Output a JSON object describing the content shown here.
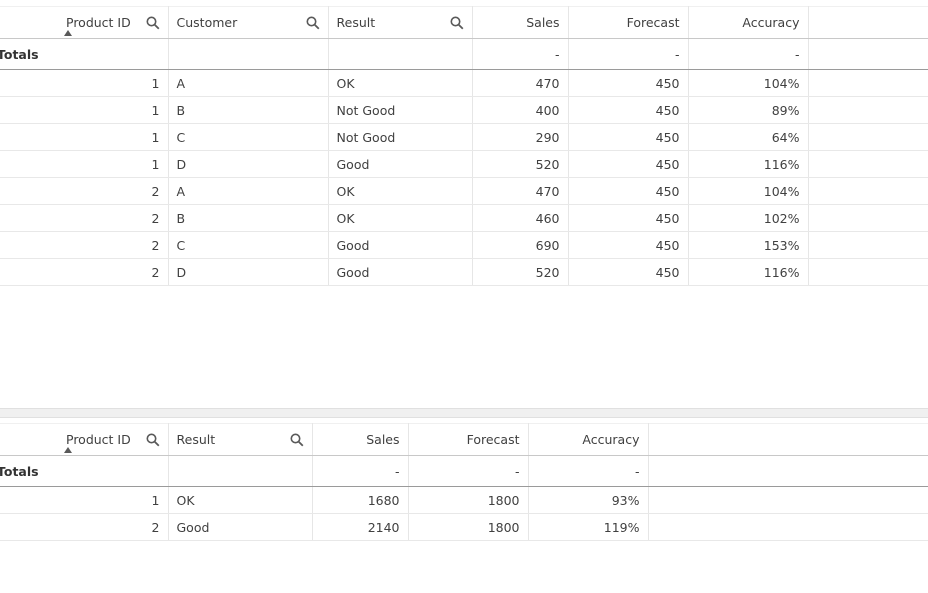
{
  "top_table": {
    "columns": {
      "product_id": "Product ID",
      "customer": "Customer",
      "result": "Result",
      "sales": "Sales",
      "forecast": "Forecast",
      "accuracy": "Accuracy"
    },
    "totals": {
      "label": "Totals",
      "sales": "-",
      "forecast": "-",
      "accuracy": "-"
    },
    "rows": [
      {
        "product_id": "1",
        "customer": "A",
        "result": "OK",
        "sales": "470",
        "forecast": "450",
        "accuracy": "104%"
      },
      {
        "product_id": "1",
        "customer": "B",
        "result": "Not Good",
        "sales": "400",
        "forecast": "450",
        "accuracy": "89%"
      },
      {
        "product_id": "1",
        "customer": "C",
        "result": "Not Good",
        "sales": "290",
        "forecast": "450",
        "accuracy": "64%"
      },
      {
        "product_id": "1",
        "customer": "D",
        "result": "Good",
        "sales": "520",
        "forecast": "450",
        "accuracy": "116%"
      },
      {
        "product_id": "2",
        "customer": "A",
        "result": "OK",
        "sales": "470",
        "forecast": "450",
        "accuracy": "104%"
      },
      {
        "product_id": "2",
        "customer": "B",
        "result": "OK",
        "sales": "460",
        "forecast": "450",
        "accuracy": "102%"
      },
      {
        "product_id": "2",
        "customer": "C",
        "result": "Good",
        "sales": "690",
        "forecast": "450",
        "accuracy": "153%"
      },
      {
        "product_id": "2",
        "customer": "D",
        "result": "Good",
        "sales": "520",
        "forecast": "450",
        "accuracy": "116%"
      }
    ]
  },
  "bottom_table": {
    "columns": {
      "product_id": "Product ID",
      "result": "Result",
      "sales": "Sales",
      "forecast": "Forecast",
      "accuracy": "Accuracy"
    },
    "totals": {
      "label": "Totals",
      "sales": "-",
      "forecast": "-",
      "accuracy": "-"
    },
    "rows": [
      {
        "product_id": "1",
        "result": "OK",
        "sales": "1680",
        "forecast": "1800",
        "accuracy": "93%"
      },
      {
        "product_id": "2",
        "result": "Good",
        "sales": "2140",
        "forecast": "1800",
        "accuracy": "119%"
      }
    ]
  },
  "icons": {
    "search": "search-icon",
    "sort": "sort-ascending-icon"
  },
  "colors": {
    "text": "#404040",
    "grid": "#e6e6e6",
    "header_border": "#c8c8c8",
    "totals_border": "#9a9a9a"
  }
}
